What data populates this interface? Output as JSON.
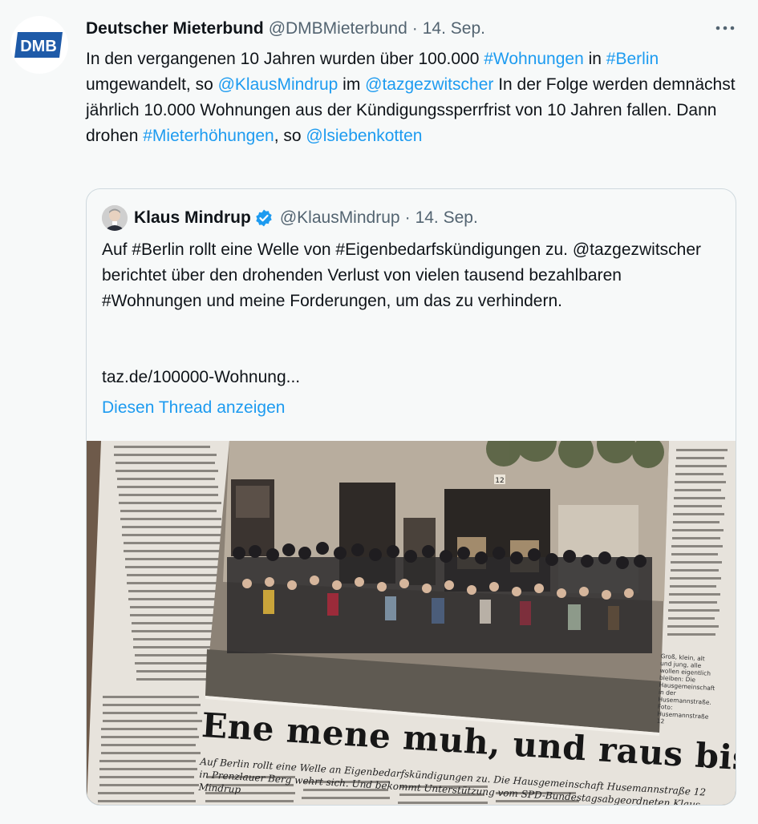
{
  "tweet": {
    "author_name": "Deutscher Mieterbund",
    "author_handle": "@DMBMieterbund",
    "separator": "·",
    "date": "14. Sep.",
    "avatar_logo_text": "DMB",
    "more_icon": "more-horizontal-icon",
    "text_parts": {
      "t1": "In den vergangenen 10 Jahren wurden über 100.000 ",
      "l1": "#Wohnungen",
      "t2": " in ",
      "l2": "#Berlin",
      "t3": " umgewandelt, so ",
      "l3": "@KlausMindrup",
      "t4": " im ",
      "l4": "@tazgezwitscher",
      "t5": " In der Folge werden demnächst jährlich 10.000 Wohnungen aus der Kündigungssperrfrist von 10 Jahren fallen. Dann drohen ",
      "l5": "#Mieterhöhungen",
      "t6": ", so ",
      "l6": "@lsiebenkotten"
    }
  },
  "quote": {
    "author_name": "Klaus Mindrup",
    "verified_icon": "verified-badge-icon",
    "author_handle": "@KlausMindrup",
    "separator": "·",
    "date": "14. Sep.",
    "text": "Auf #Berlin rollt eine Welle von #Eigenbedarfskündigungen zu. @tazgezwitscher berichtet über den drohenden Verlust von vielen tausend bezahlbaren #Wohnungen und meine Forderungen, um das zu verhindern.",
    "url": "taz.de/100000-Wohnung...",
    "thread_link": "Diesen Thread anzeigen",
    "media": {
      "headline": "Ene mene muh, und raus bist du",
      "subline": "Auf Berlin rollt eine Welle an Eigenbedarfskündigungen zu. Die Hausgemeinschaft Husemannstraße 12 in Prenzlauer Berg wehrt sich. Und bekommt Unterstützung vom SPD-Bundestagsabgeordneten Klaus Mindrup",
      "caption": "Groß, klein, alt und jung, alle wollen eigentlich bleiben: Die Hausgemeinschaft in der Husemannstraße. Foto: Husemannstraße 12",
      "house_number": "12"
    }
  },
  "colors": {
    "background": "#f7f9f9",
    "text": "#0f1419",
    "secondary": "#536471",
    "link": "#1d9bf0",
    "border": "#cfd9de",
    "dmb_blue": "#1e5aa8"
  }
}
